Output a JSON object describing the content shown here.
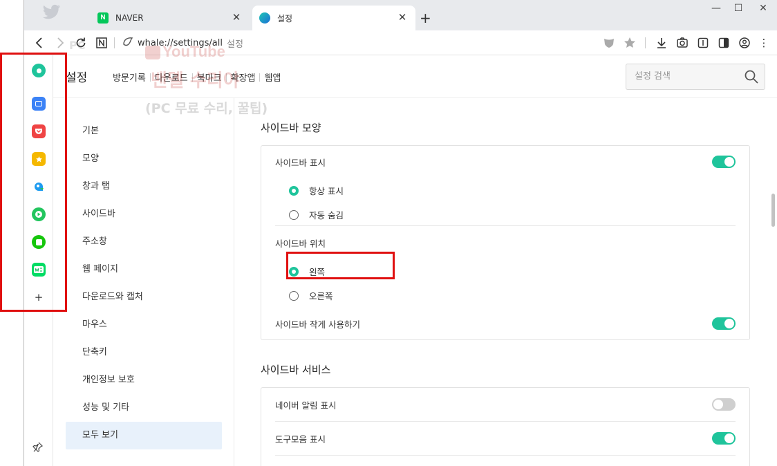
{
  "tabs": [
    {
      "title": "NAVER",
      "favicon": "naver-icon",
      "favicon_text": "N",
      "active": false
    },
    {
      "title": "설정",
      "favicon": "whale-icon",
      "active": true
    }
  ],
  "window_controls": {
    "minimize": "—",
    "maximize": "☐",
    "close": "✕"
  },
  "toolbar": {
    "url": "whale://settings/all",
    "page_title": "설정"
  },
  "sidebar": {
    "items": [
      {
        "name": "green-circle-app-icon",
        "color": "#1fc49b"
      },
      {
        "name": "calendar-app-icon",
        "color": "#3b82f6"
      },
      {
        "name": "pocket-app-icon",
        "color": "#ef4444"
      },
      {
        "name": "bookmark-star-app-icon",
        "color": "#f5b800"
      },
      {
        "name": "papago-app-icon",
        "color": "#1d9bf0"
      },
      {
        "name": "play-app-icon",
        "color": "#22c55e"
      },
      {
        "name": "naver-square-app-icon",
        "color": "#16c60c"
      },
      {
        "name": "webtoon-app-icon",
        "color": "#00dc64"
      },
      {
        "name": "add-app-icon",
        "label": "+"
      }
    ]
  },
  "watermark": {
    "pc": "PC",
    "youtube": "YouTube",
    "title": "밴뎰 수리야",
    "subtitle": "(PC 무료 수리, 꿀팁)"
  },
  "settings": {
    "title": "설정",
    "nav": [
      "방문기록",
      "다운로드",
      "북마크",
      "확장앱",
      "웹앱"
    ],
    "search_placeholder": "설정 검색",
    "menu": [
      "기본",
      "모양",
      "창과 탭",
      "사이드바",
      "주소창",
      "웹 페이지",
      "다운로드와 캡처",
      "마우스",
      "단축키",
      "개인정보 보호",
      "성능 및 기타",
      "모두 보기"
    ],
    "active_menu": "모두 보기"
  },
  "content": {
    "section1": {
      "title": "사이드바 모양",
      "show_label": "사이드바 표시",
      "show_toggle": true,
      "show_options": [
        "항상 표시",
        "자동 숨김"
      ],
      "show_selected": "항상 표시",
      "position_label": "사이드바 위치",
      "position_options": [
        "왼쪽",
        "오른쪽"
      ],
      "position_selected": "왼쪽",
      "small_label": "사이드바 작게 사용하기",
      "small_toggle": true
    },
    "section2": {
      "title": "사이드바 서비스",
      "naver_alarm_label": "네이버 알림 표시",
      "naver_alarm_toggle": false,
      "toolbox_label": "도구모음 표시",
      "toolbox_toggle": true
    }
  },
  "accent_color": "#1fc49b",
  "highlight_color": "#e01010"
}
